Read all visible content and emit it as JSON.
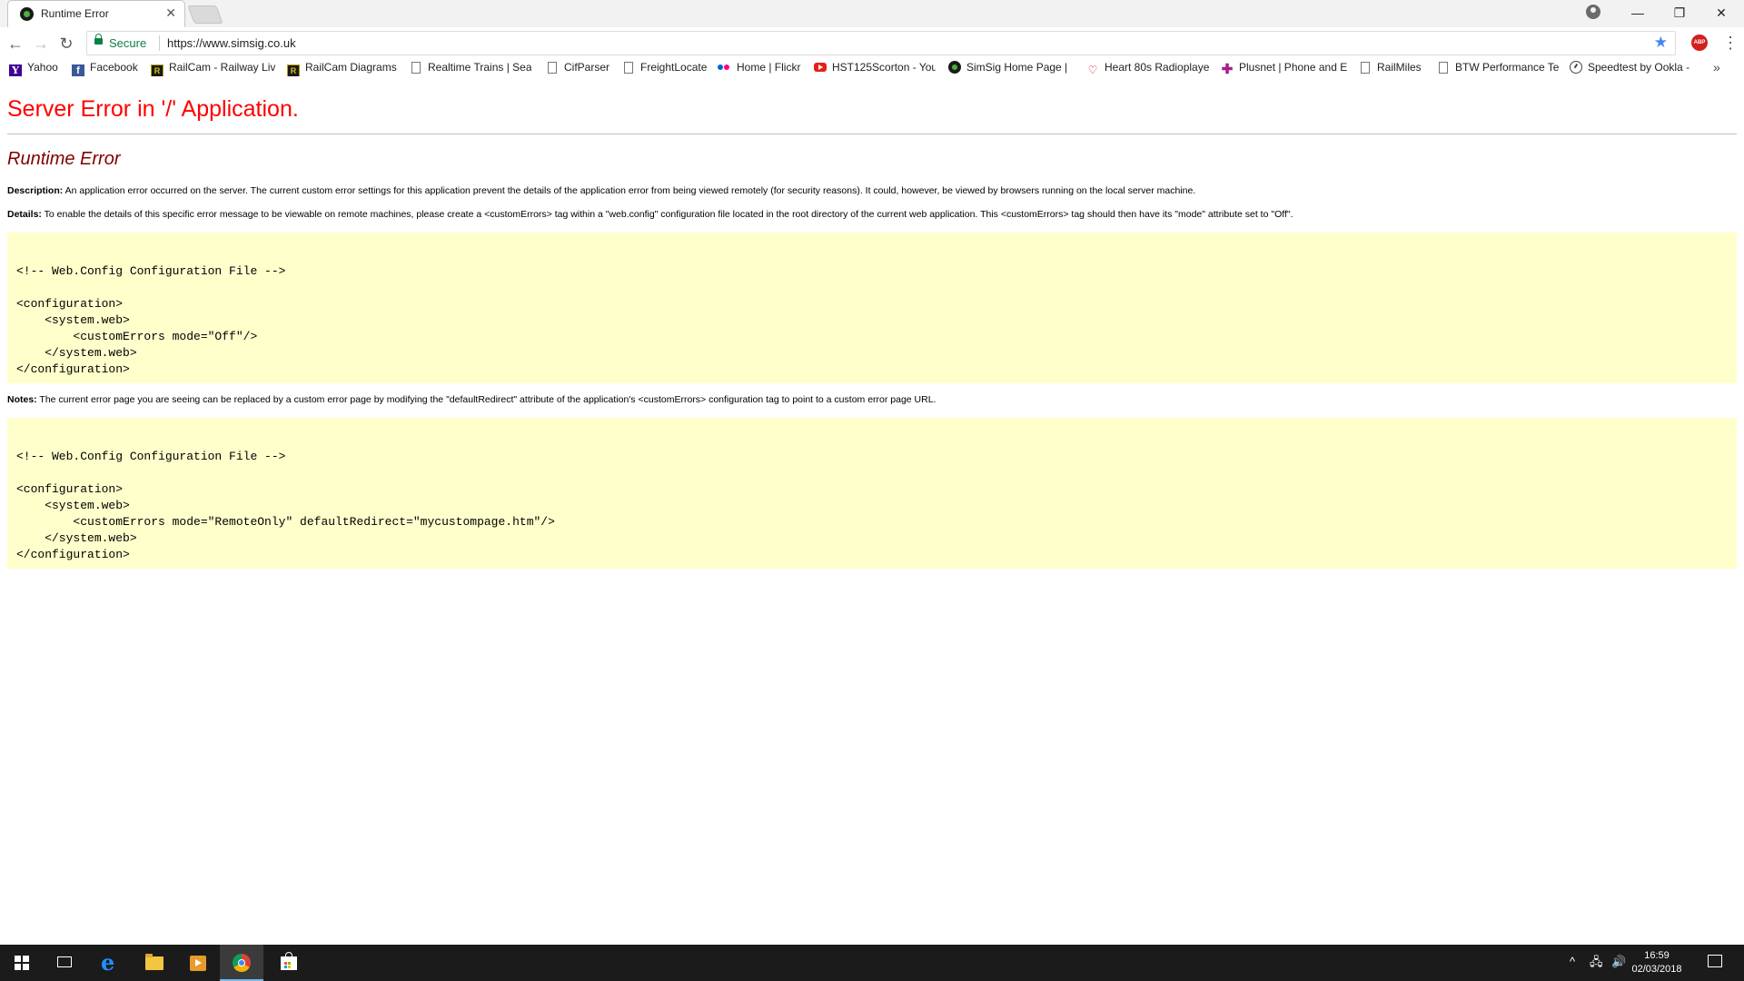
{
  "browser": {
    "tab_title": "Runtime Error",
    "tab_close": "✕",
    "secure_label": "Secure",
    "url": "https://www.simsig.co.uk",
    "window_controls": {
      "minimize": "—",
      "restore": "❐",
      "close": "✕"
    }
  },
  "bookmarks": [
    {
      "label": "Yahoo",
      "icon": "yahoo-icon",
      "glyph": "Y"
    },
    {
      "label": "Facebook",
      "icon": "facebook-icon",
      "glyph": "f"
    },
    {
      "label": "RailCam - Railway Liv",
      "icon": "railcam-icon",
      "glyph": "R"
    },
    {
      "label": "RailCam Diagrams",
      "icon": "railcam-icon",
      "glyph": "R"
    },
    {
      "label": "Realtime Trains | Sear",
      "icon": "page-icon",
      "glyph": ""
    },
    {
      "label": "CifParser",
      "icon": "page-icon",
      "glyph": ""
    },
    {
      "label": "FreightLocate",
      "icon": "page-icon",
      "glyph": ""
    },
    {
      "label": "Home | Flickr",
      "icon": "flickr-icon",
      "glyph": ""
    },
    {
      "label": "HST125Scorton - You",
      "icon": "youtube-icon",
      "glyph": ""
    },
    {
      "label": "SimSig Home Page |",
      "icon": "simsig-icon",
      "glyph": ""
    },
    {
      "label": "Heart 80s Radioplaye",
      "icon": "heart-icon",
      "glyph": "♡"
    },
    {
      "label": "Plusnet | Phone and E",
      "icon": "plusnet-icon",
      "glyph": "✚"
    },
    {
      "label": "RailMiles",
      "icon": "page-icon",
      "glyph": ""
    },
    {
      "label": "BTW Performance Te",
      "icon": "page-icon",
      "glyph": ""
    },
    {
      "label": "Speedtest by Ookla -",
      "icon": "speedtest-icon",
      "glyph": ""
    }
  ],
  "bookmarks_more": "»",
  "error_page": {
    "heading": "Server Error in '/' Application.",
    "subheading": "Runtime Error",
    "description_label": "Description:",
    "description_text": " An application error occurred on the server. The current custom error settings for this application prevent the details of the application error from being viewed remotely (for security reasons). It could, however, be viewed by browsers running on the local server machine.",
    "details_label": "Details:",
    "details_text": " To enable the details of this specific error message to be viewable on remote machines, please create a <customErrors> tag within a \"web.config\" configuration file located in the root directory of the current web application. This <customErrors> tag should then have its \"mode\" attribute set to \"Off\".",
    "code_1": "\n<!-- Web.Config Configuration File -->\n\n<configuration>\n    <system.web>\n        <customErrors mode=\"Off\"/>\n    </system.web>\n</configuration>",
    "notes_label": "Notes:",
    "notes_text": " The current error page you are seeing can be replaced by a custom error page by modifying the \"defaultRedirect\" attribute of the application's <customErrors> configuration tag to point to a custom error page URL.",
    "code_2": "\n<!-- Web.Config Configuration File -->\n\n<configuration>\n    <system.web>\n        <customErrors mode=\"RemoteOnly\" defaultRedirect=\"mycustompage.htm\"/>\n    </system.web>\n</configuration>"
  },
  "taskbar": {
    "time": "16:59",
    "date": "02/03/2018",
    "tray_chevron": "^",
    "tray_network": "🖧",
    "tray_volume": "🔊"
  },
  "colors": {
    "error_heading": "#ff0000",
    "subheading": "#800000",
    "code_background": "#ffffcc",
    "secure_green": "#0b8043",
    "taskbar": "#1b1b1b"
  }
}
